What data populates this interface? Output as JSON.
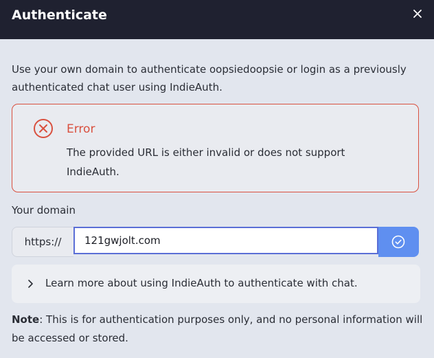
{
  "dialog": {
    "title": "Authenticate",
    "close_icon": "close-icon"
  },
  "intro": {
    "text": "Use your own domain to authenticate oopsiedoopsie or login as a previously authenticated chat user using IndieAuth."
  },
  "error": {
    "icon": "error-circle-x-icon",
    "title": "Error",
    "message": "The provided URL is either invalid or does not support IndieAuth.",
    "color": "#d9503f"
  },
  "domain": {
    "label": "Your domain",
    "prefix": "https://",
    "value": "121gwjolt.com",
    "submit_icon": "check-circle-icon",
    "accent_color": "#5f8ff0"
  },
  "learn_more": {
    "icon": "chevron-right-icon",
    "text": "Learn more about using IndieAuth to authenticate with chat."
  },
  "note": {
    "label": "Note",
    "text": ": This is for authentication purposes only, and no personal information will be accessed or stored."
  },
  "colors": {
    "header_bg": "#1f2130",
    "body_bg": "#e2e6ee"
  }
}
